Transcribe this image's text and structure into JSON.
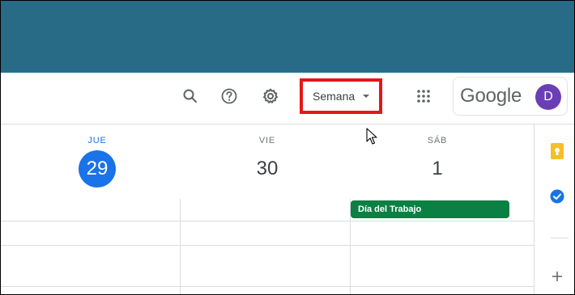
{
  "toolbar": {
    "view_selector_label": "Semana",
    "google_wordmark": "Google",
    "avatar_initial": "D"
  },
  "icons": {
    "search": "search-icon",
    "help": "help-icon",
    "settings": "gear-icon",
    "apps": "apps-grid-icon",
    "dropdown": "chevron-down-icon",
    "cursor": "mouse-pointer-icon",
    "keep": "keep-icon",
    "tasks": "tasks-icon",
    "add": "plus-icon"
  },
  "days": [
    {
      "name": "JUE",
      "number": "29",
      "today": true
    },
    {
      "name": "VIE",
      "number": "30",
      "today": false
    },
    {
      "name": "SÁB",
      "number": "1",
      "today": false
    }
  ],
  "events": [
    {
      "title": "Día del Trabajo",
      "day": "SÁB",
      "color": "#0b8043"
    }
  ],
  "colors": {
    "topbar": "#276b87",
    "accent_blue": "#1a73e8",
    "avatar": "#6a3fb5",
    "highlight_box": "#e5161a",
    "event_green": "#0b8043",
    "keep_yellow": "#f6bf26"
  }
}
